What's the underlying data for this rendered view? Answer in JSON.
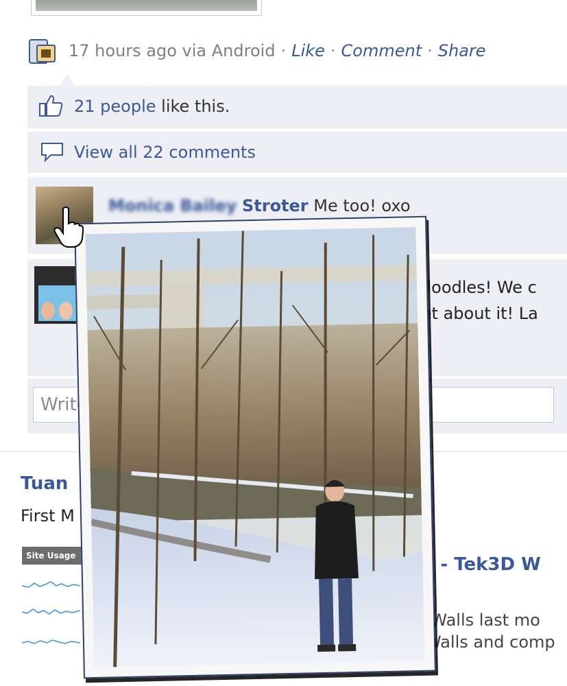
{
  "story": {
    "time": "17 hours ago",
    "via_prefix": "via",
    "via_app": "Android",
    "actions": [
      "Like",
      "Comment",
      "Share"
    ]
  },
  "likes": {
    "count_text": "21 people",
    "suffix": " like this."
  },
  "comments_link": {
    "prefix": "View all ",
    "count": "22 comments"
  },
  "comment1": {
    "author_blurred": "Monica Bailey",
    "author_last": "Stroter",
    "text": "Me too! oxo"
  },
  "comment2": {
    "line1": "kdoodles! We c",
    "line2": "eet about it! La"
  },
  "write_box": {
    "placeholder": "Write"
  },
  "post2": {
    "name": "Tuan",
    "text": "First M",
    "badge": "Site Usage",
    "link_title": "lls - Tek3D W",
    "line1": "chWalls last mo",
    "line2": "Walls and comp"
  },
  "icons": [
    "android-app-icon",
    "thumbs-up-icon",
    "comment-bubble-icon",
    "hand-cursor-icon"
  ],
  "colors": {
    "link": "#3b5998",
    "feedback_bg": "#edeff4",
    "muted": "#808080"
  }
}
